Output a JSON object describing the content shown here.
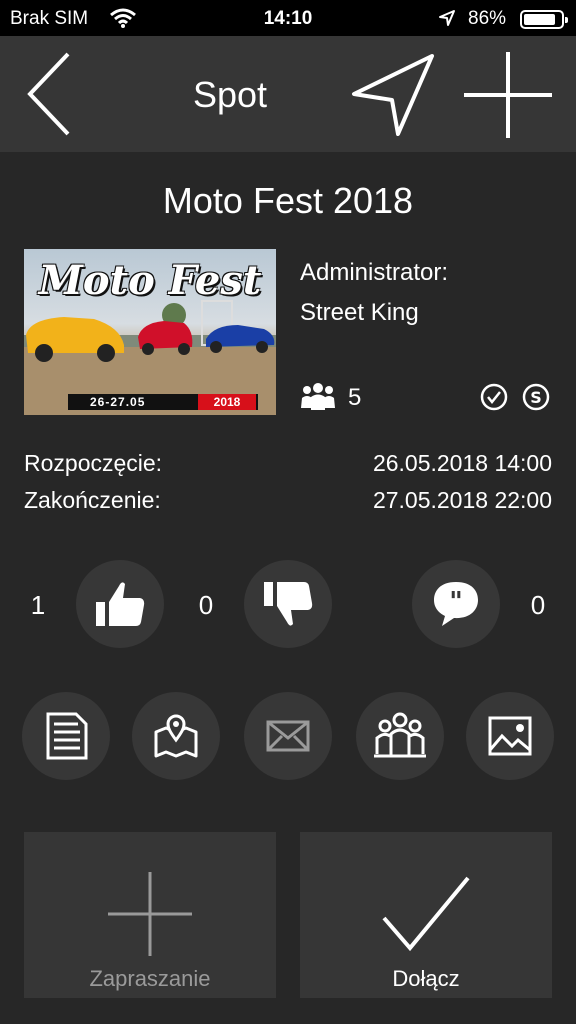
{
  "status_bar": {
    "carrier": "Brak SIM",
    "time": "14:10",
    "battery": "86%",
    "battery_level": 0.86
  },
  "nav": {
    "title": "Spot",
    "back_icon": "chevron-left-icon",
    "send_icon": "location-arrow-icon",
    "add_icon": "plus-icon"
  },
  "event": {
    "title": "Moto Fest 2018",
    "image": {
      "title": "Moto Fest",
      "dates": "26-27.05",
      "year": "2018"
    },
    "admin_label": "Administrator:",
    "admin_name": "Street King",
    "members_count": "5",
    "start_label": "Rozpoczęcie:",
    "start_value": "26.05.2018 14:00",
    "end_label": "Zakończenie:",
    "end_value": "27.05.2018 22:00"
  },
  "reactions": {
    "likes": "1",
    "dislikes": "0",
    "comments": "0"
  },
  "tools": [
    {
      "icon": "document-icon"
    },
    {
      "icon": "map-pin-icon"
    },
    {
      "icon": "envelope-icon"
    },
    {
      "icon": "group-icon"
    },
    {
      "icon": "image-icon"
    }
  ],
  "actions": {
    "invite_label": "Zapraszanie",
    "join_label": "Dołącz"
  },
  "colors": {
    "background": "#272727",
    "bar": "#363636",
    "circle": "#373737",
    "text": "#ffffff",
    "muted": "#9a9a9a"
  }
}
